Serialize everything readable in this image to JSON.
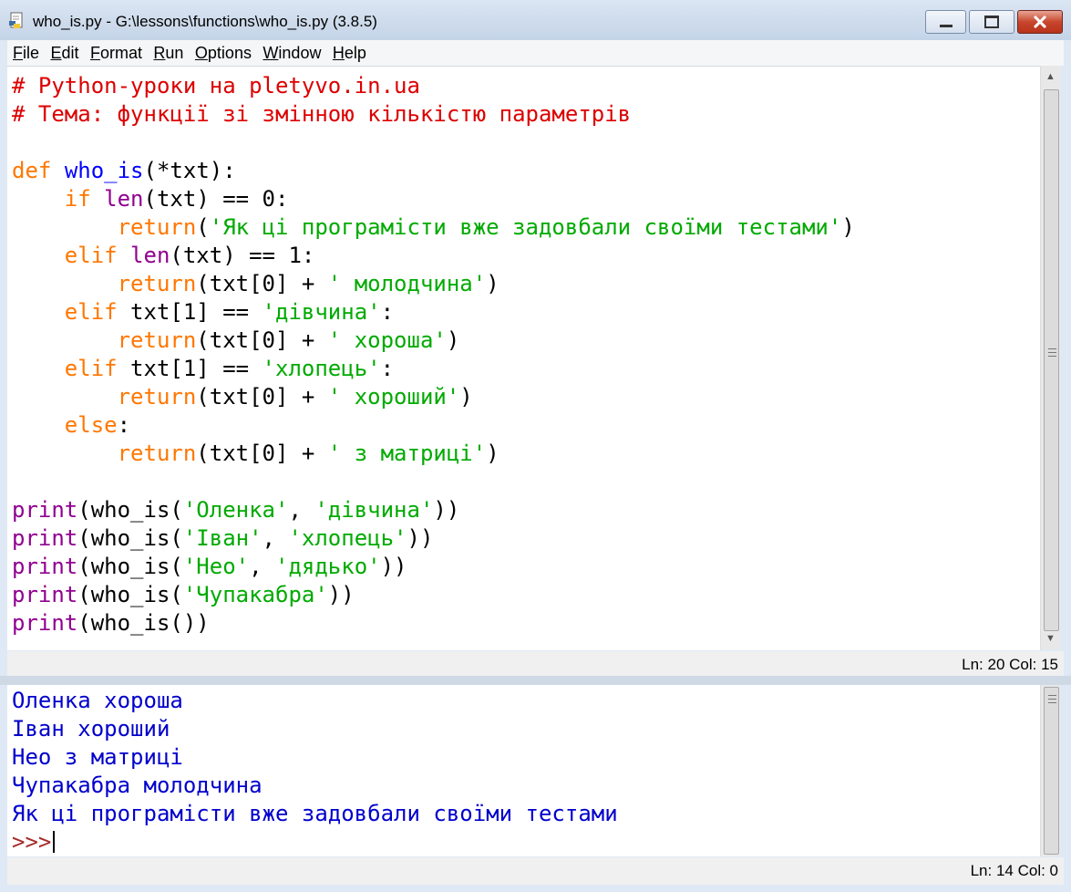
{
  "window": {
    "title": "who_is.py - G:\\lessons\\functions\\who_is.py (3.8.5)",
    "app_icon": "python-file-icon"
  },
  "menu": [
    {
      "label": "File"
    },
    {
      "label": "Edit"
    },
    {
      "label": "Format"
    },
    {
      "label": "Run"
    },
    {
      "label": "Options"
    },
    {
      "label": "Window"
    },
    {
      "label": "Help"
    }
  ],
  "editor": {
    "lines": [
      "# Python-уроки на pletyvo.in.ua",
      "# Тема: функції зі змінною кількістю параметрів",
      "",
      "def who_is(*txt):",
      "    if len(txt) == 0:",
      "        return('Як ці програмісти вже задовбали своїми тестами')",
      "    elif len(txt) == 1:",
      "        return(txt[0] + ' молодчина')",
      "    elif txt[1] == 'дівчина':",
      "        return(txt[0] + ' хороша')",
      "    elif txt[1] == 'хлопець':",
      "        return(txt[0] + ' хороший')",
      "    else:",
      "        return(txt[0] + ' з матриці')",
      "",
      "print(who_is('Оленка', 'дівчина'))",
      "print(who_is('Іван', 'хлопець'))",
      "print(who_is('Нео', 'дядько'))",
      "print(who_is('Чупакабра'))",
      "print(who_is())"
    ],
    "status": "Ln: 20  Col: 15"
  },
  "shell": {
    "output": [
      "Оленка хороша",
      "Іван хороший",
      "Нео з матриці",
      "Чупакабра молодчина",
      "Як ці програмісти вже задовбали своїми тестами"
    ],
    "prompt": ">>>",
    "status": "Ln: 14  Col: 0"
  },
  "colors": {
    "comment": "#dd0000",
    "keyword": "#ff7700",
    "definition": "#0000ff",
    "string": "#00aa00",
    "builtin": "#900090",
    "shell_output": "#0000cc",
    "prompt": "#a52a2a"
  }
}
